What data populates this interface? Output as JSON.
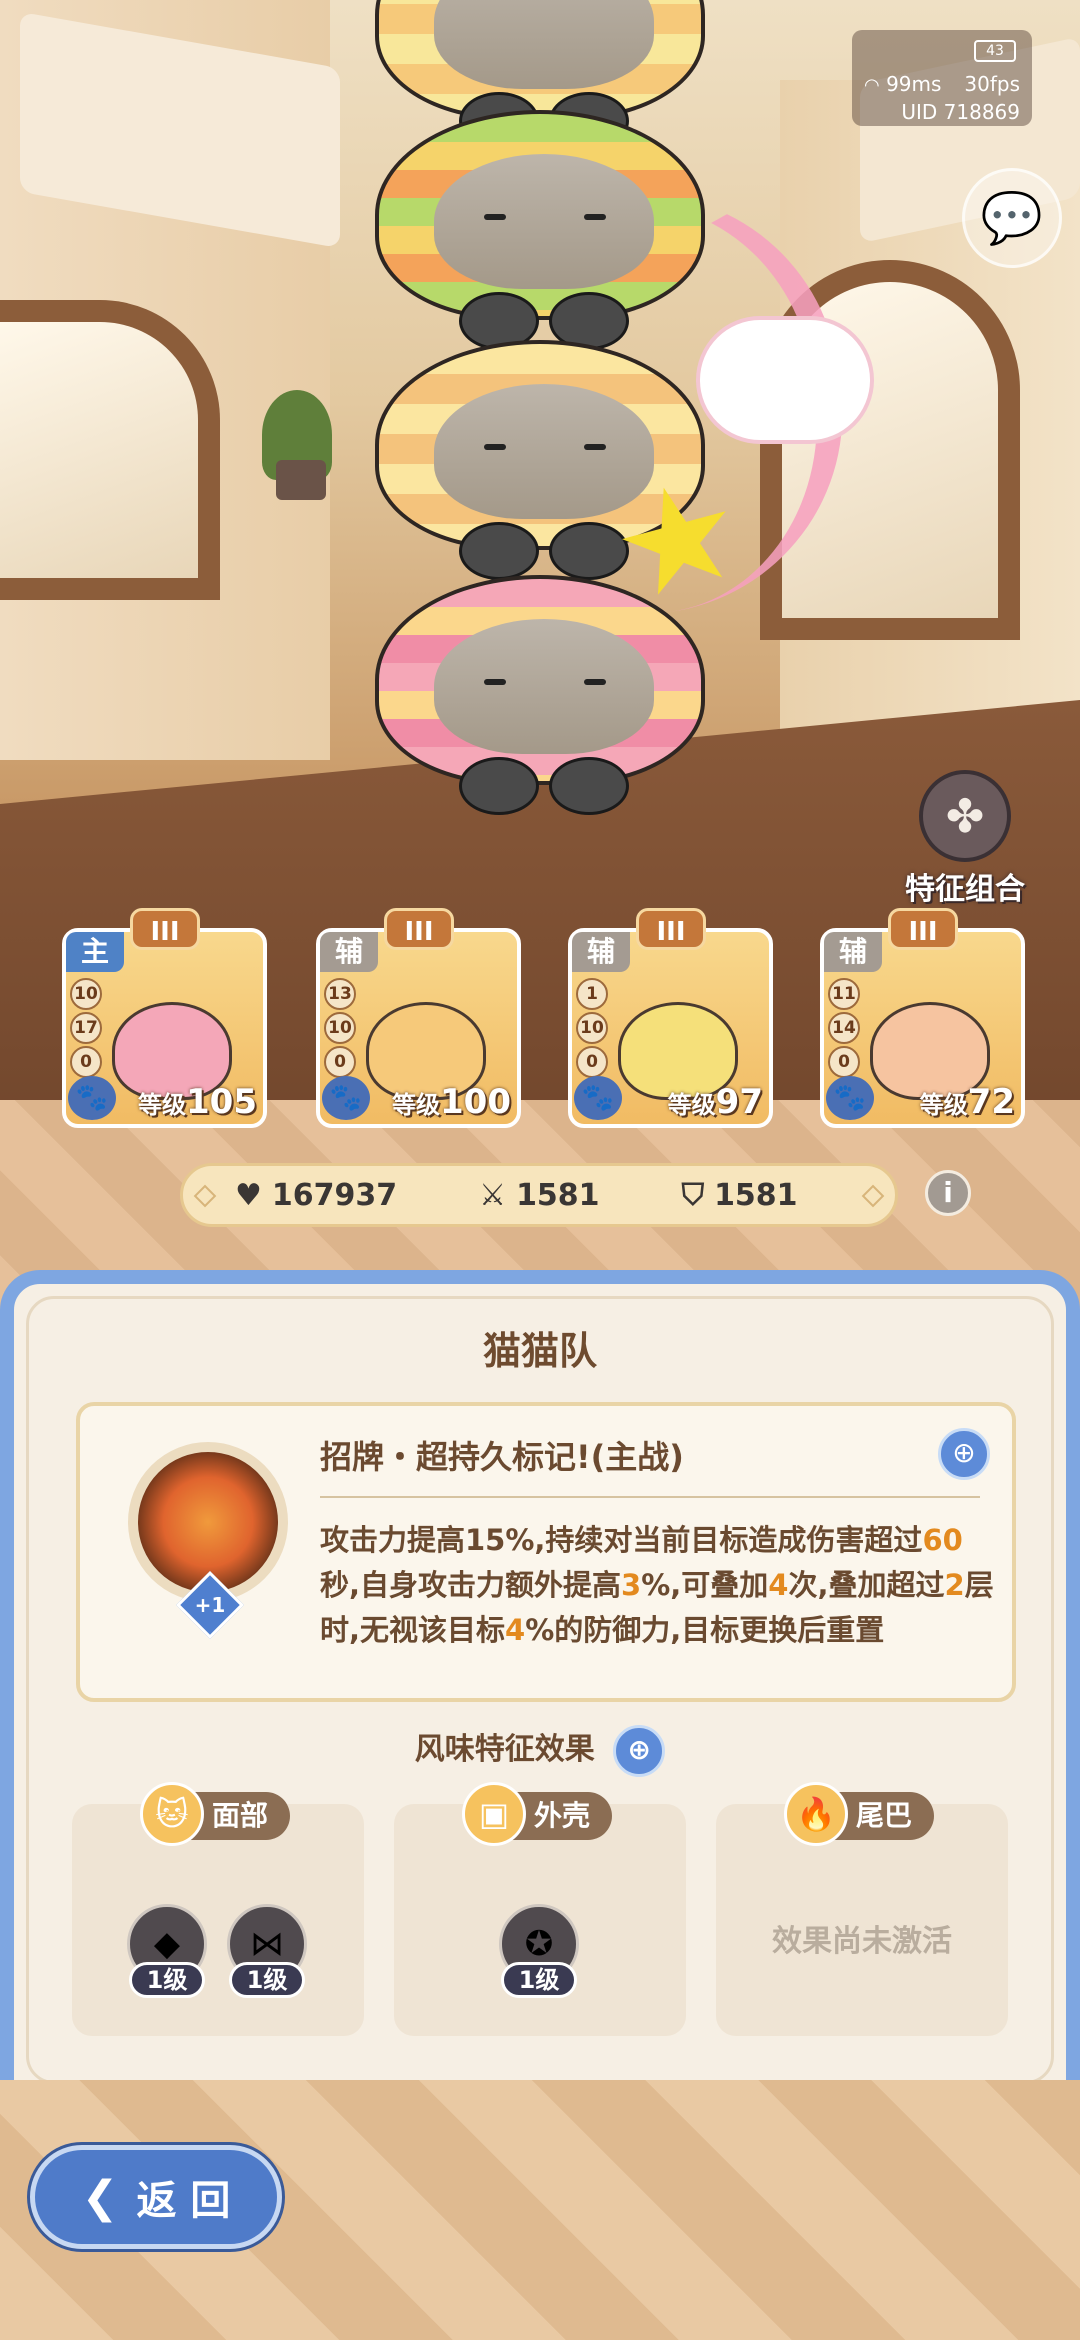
{
  "status": {
    "battery": "43",
    "ping": "99ms",
    "fps": "30fps",
    "uid": "UID 718869"
  },
  "feature_combo": {
    "label": "特征组合",
    "icon": "clover-icon"
  },
  "chat": {
    "icon": "chat-bubble-icon"
  },
  "team_cards": [
    {
      "role": "主",
      "rank": "III",
      "stats": [
        "10",
        "17",
        "0"
      ],
      "level_label": "等级",
      "level": "105",
      "face_color": "#f4a7b8"
    },
    {
      "role": "辅",
      "rank": "III",
      "stats": [
        "13",
        "10",
        "0"
      ],
      "level_label": "等级",
      "level": "100",
      "face_color": "#f6c97a"
    },
    {
      "role": "辅",
      "rank": "III",
      "stats": [
        "1",
        "10",
        "0"
      ],
      "level_label": "等级",
      "level": "97",
      "face_color": "#f5e07a"
    },
    {
      "role": "辅",
      "rank": "III",
      "stats": [
        "11",
        "14",
        "0"
      ],
      "level_label": "等级",
      "level": "72",
      "face_color": "#f6c4a0"
    }
  ],
  "totals": {
    "hp": "167937",
    "attack": "1581",
    "defense": "1581"
  },
  "panel": {
    "title": "猫猫队",
    "skill": {
      "name": "招牌・超持久标记!(主战)",
      "plus": "+1",
      "desc_1": "攻击力提高15%,持续对当前目标造成伤害超过",
      "desc_60": "60",
      "desc_2": "秒,自身攻击力额外提高",
      "desc_3": "3",
      "desc_4": "%,可叠加",
      "desc_5": "4",
      "desc_6": "次,叠加超过",
      "desc_7": "2",
      "desc_8": "层时,无视该目标",
      "desc_9": "4",
      "desc_10": "%的防御力,目标更换后重置"
    },
    "traits_title": "风味特征效果",
    "traits": [
      {
        "name": "面部",
        "badges": [
          "1级",
          "1级"
        ]
      },
      {
        "name": "外壳",
        "badges": [
          "1级"
        ]
      },
      {
        "name": "尾巴",
        "inactive": "效果尚未激活"
      }
    ]
  },
  "back": {
    "label": "返 回"
  }
}
